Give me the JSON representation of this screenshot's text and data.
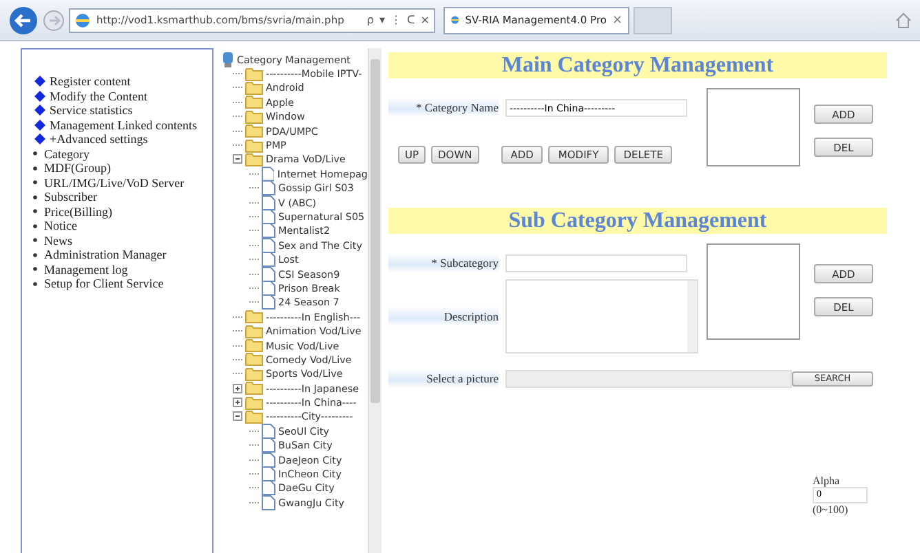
{
  "browser": {
    "address": "http://vod1.ksmarthub.com/bms/svria/main.php",
    "address_controls": [
      "ρ",
      "▾",
      "⋮",
      "ᑕ",
      "×"
    ],
    "tab": {
      "title": "SV-RIA Management4.0 Pro",
      "close": "×"
    }
  },
  "nav": {
    "items": [
      {
        "label": "Register content",
        "kind": "main"
      },
      {
        "label": "Modify the Content",
        "kind": "main"
      },
      {
        "label": "Service statistics",
        "kind": "main"
      },
      {
        "label": "Management Linked contents",
        "kind": "main"
      },
      {
        "label": "+Advanced settings",
        "kind": "main"
      },
      {
        "label": "Category",
        "kind": "sub"
      },
      {
        "label": "MDF(Group)",
        "kind": "sub"
      },
      {
        "label": "URL/IMG/Live/VoD Server",
        "kind": "sub"
      },
      {
        "label": "Subscriber",
        "kind": "sub"
      },
      {
        "label": "Price(Billing)",
        "kind": "sub"
      },
      {
        "label": "Notice",
        "kind": "sub"
      },
      {
        "label": "News",
        "kind": "sub"
      },
      {
        "label": "Administration Manager",
        "kind": "sub"
      },
      {
        "label": "Management log",
        "kind": "sub"
      },
      {
        "label": "Setup for Client Service",
        "kind": "sub"
      }
    ]
  },
  "tree": {
    "label": "Category Management",
    "kind": "root",
    "children": [
      {
        "label": "----------Mobile IPTV-",
        "kind": "folder"
      },
      {
        "label": "Android",
        "kind": "folder"
      },
      {
        "label": "Apple",
        "kind": "folder"
      },
      {
        "label": "Window",
        "kind": "folder"
      },
      {
        "label": "PDA/UMPC",
        "kind": "folder"
      },
      {
        "label": "PMP",
        "kind": "folder"
      },
      {
        "label": "Drama VoD/Live",
        "kind": "folder",
        "expanded": true,
        "children": [
          {
            "label": "Internet Homepag",
            "kind": "page"
          },
          {
            "label": "Gossip Girl S03",
            "kind": "page"
          },
          {
            "label": "V (ABC)",
            "kind": "page"
          },
          {
            "label": "Supernatural S05",
            "kind": "page"
          },
          {
            "label": "Mentalist2",
            "kind": "page"
          },
          {
            "label": "Sex and The City",
            "kind": "page"
          },
          {
            "label": "Lost",
            "kind": "page"
          },
          {
            "label": "CSI Season9",
            "kind": "page"
          },
          {
            "label": "Prison Break",
            "kind": "page"
          },
          {
            "label": "24 Season 7",
            "kind": "page"
          }
        ]
      },
      {
        "label": "----------In English---",
        "kind": "folder"
      },
      {
        "label": "Animation Vod/Live",
        "kind": "folder"
      },
      {
        "label": "Music Vod/Live",
        "kind": "folder"
      },
      {
        "label": "Comedy Vod/Live",
        "kind": "folder"
      },
      {
        "label": "Sports Vod/Live",
        "kind": "folder"
      },
      {
        "label": "----------In Japanese",
        "kind": "folder",
        "expanded": false
      },
      {
        "label": "----------In China----",
        "kind": "folder",
        "expanded": false
      },
      {
        "label": "----------City---------",
        "kind": "folder",
        "expanded": true,
        "children": [
          {
            "label": "SeoUl City",
            "kind": "page"
          },
          {
            "label": "BuSan City",
            "kind": "page"
          },
          {
            "label": "DaeJeon City",
            "kind": "page"
          },
          {
            "label": "InCheon City",
            "kind": "page"
          },
          {
            "label": "DaeGu City",
            "kind": "page"
          },
          {
            "label": "GwangJu City",
            "kind": "page"
          }
        ]
      }
    ]
  },
  "main_category": {
    "title": "Main Category Management",
    "name_label": "* Category Name",
    "name_value": "----------In China---------",
    "order_buttons": [
      "UP",
      "DOWN"
    ],
    "edit_buttons": [
      "ADD",
      "MODIFY",
      "DELETE"
    ],
    "side_buttons": [
      "ADD",
      "DEL"
    ]
  },
  "sub_category": {
    "title": "Sub Category Management",
    "subcategory_label": "* Subcategory",
    "description_label": "Description",
    "side_buttons": [
      "ADD",
      "DEL"
    ],
    "picture_label": "Select a picture",
    "search_button": "SEARCH"
  },
  "alpha": {
    "label": "Alpha",
    "value": "0",
    "range": "(0~100)"
  }
}
